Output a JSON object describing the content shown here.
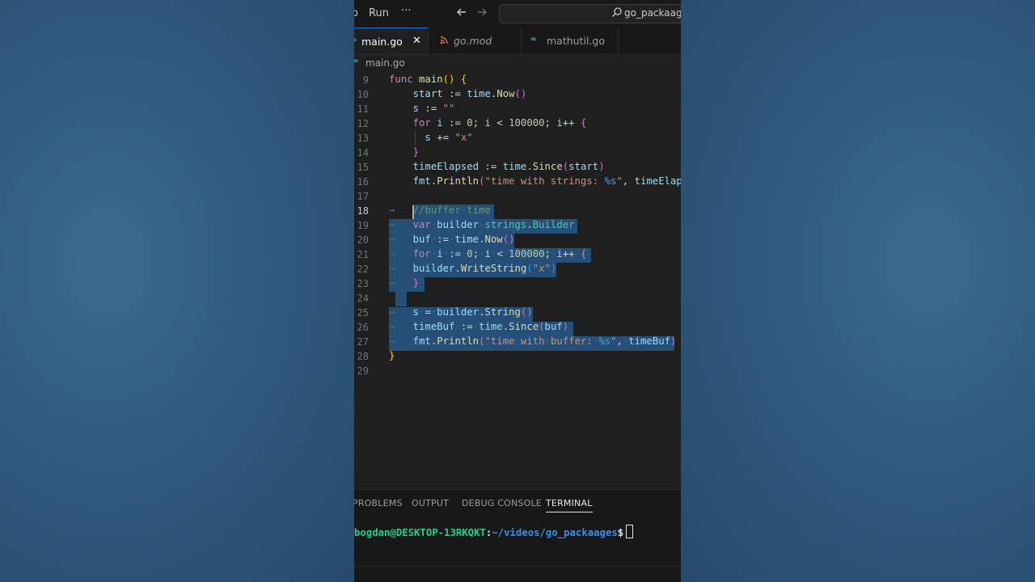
{
  "menu": {
    "partial_item": "o",
    "run": "Run",
    "more": "···"
  },
  "nav": {
    "back_icon": "arrow-left-icon",
    "forward_icon": "arrow-right-icon"
  },
  "search": {
    "text": "go_packaages"
  },
  "tabs": [
    {
      "label": "main.go",
      "icon": "go-icon",
      "active": true,
      "close": "✕"
    },
    {
      "label": "go.mod",
      "icon": "rss-icon",
      "active": false
    },
    {
      "label": "mathutil.go",
      "icon": "go-icon",
      "active": false
    }
  ],
  "breadcrumb": {
    "file": "main.go"
  },
  "editor": {
    "current_line": "18",
    "lines": [
      {
        "n": "9",
        "text": "func main() {"
      },
      {
        "n": "10",
        "text": "start := time.Now()"
      },
      {
        "n": "11",
        "text": "s := \"\""
      },
      {
        "n": "12",
        "text": "for i := 0; i < 100000; i++ {"
      },
      {
        "n": "13",
        "text": "s += \"x\""
      },
      {
        "n": "14",
        "text": "}"
      },
      {
        "n": "15",
        "text": "timeElapsed := time.Since(start)"
      },
      {
        "n": "16",
        "text": "fmt.Println(\"time with strings: %s\", timeElaps"
      },
      {
        "n": "17",
        "text": ""
      },
      {
        "n": "18",
        "text": "//buffer time"
      },
      {
        "n": "19",
        "text": "var builder strings.Builder"
      },
      {
        "n": "20",
        "text": "buf := time.Now()"
      },
      {
        "n": "21",
        "text": "for i := 0; i < 100000; i++ {"
      },
      {
        "n": "22",
        "text": "builder.WriteString(\"x\")"
      },
      {
        "n": "23",
        "text": "}"
      },
      {
        "n": "24",
        "text": ""
      },
      {
        "n": "25",
        "text": "s = builder.String()"
      },
      {
        "n": "26",
        "text": "timeBuf := time.Since(buf)"
      },
      {
        "n": "27",
        "text": "fmt.Println(\"time with buffer: %s\", timeBuf)"
      },
      {
        "n": "28",
        "text": "}"
      },
      {
        "n": "29",
        "text": ""
      }
    ]
  },
  "panel": {
    "tabs": [
      "PROBLEMS",
      "OUTPUT",
      "DEBUG CONSOLE",
      "TERMINAL"
    ],
    "active_tab": "TERMINAL",
    "terminal": {
      "user": "bogdan@DESKTOP-13RKQKT",
      "sep": ":",
      "path": "~/videos/go_packaages",
      "prompt": "$"
    }
  },
  "colors": {
    "background": "#2f5577",
    "editor_bg": "#1f1f1f",
    "selection": "#264f78",
    "accent": "#0078d4"
  }
}
